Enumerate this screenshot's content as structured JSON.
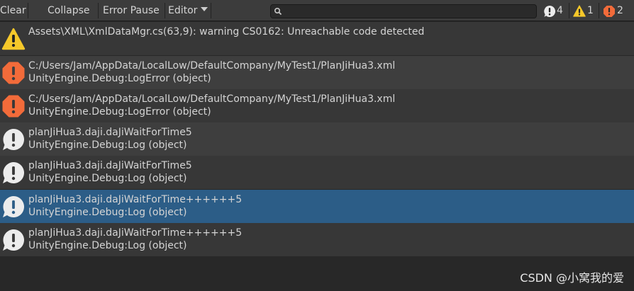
{
  "toolbar": {
    "clear_label": "Clear",
    "collapse_label": "Collapse",
    "error_pause_label": "Error Pause",
    "editor_label": "Editor",
    "search_value": "",
    "counts": {
      "info": "4",
      "warning": "1",
      "error": "2"
    }
  },
  "log": [
    {
      "type": "warning",
      "line1": "Assets\\XML\\XmlDataMgr.cs(63,9): warning CS0162: Unreachable code detected",
      "line2": "",
      "selected": false
    },
    {
      "type": "error",
      "line1": "C:/Users/Jam/AppData/LocalLow/DefaultCompany/MyTest1/PlanJiHua3.xml",
      "line2": "UnityEngine.Debug:LogError (object)",
      "selected": false
    },
    {
      "type": "error",
      "line1": "C:/Users/Jam/AppData/LocalLow/DefaultCompany/MyTest1/PlanJiHua3.xml",
      "line2": "UnityEngine.Debug:LogError (object)",
      "selected": false
    },
    {
      "type": "info",
      "line1": "planJiHua3.daji.daJiWaitForTime5",
      "line2": "UnityEngine.Debug:Log (object)",
      "selected": false
    },
    {
      "type": "info",
      "line1": "planJiHua3.daji.daJiWaitForTime5",
      "line2": "UnityEngine.Debug:Log (object)",
      "selected": false
    },
    {
      "type": "info",
      "line1": "planJiHua3.daji.daJiWaitForTime++++++5",
      "line2": "UnityEngine.Debug:Log (object)",
      "selected": true
    },
    {
      "type": "info",
      "line1": "planJiHua3.daji.daJiWaitForTime++++++5",
      "line2": "UnityEngine.Debug:Log (object)",
      "selected": false
    }
  ],
  "colors": {
    "row_dark": "#373737",
    "row_light": "#3e3e3e",
    "row_selected": "#2c5d87",
    "warning": "#f5c82a",
    "error": "#f26b3a",
    "info": "#ececec"
  },
  "icons": {
    "warning": "warning-icon",
    "error": "error-icon",
    "info": "info-icon"
  },
  "watermark": "CSDN @小窝我的爱"
}
